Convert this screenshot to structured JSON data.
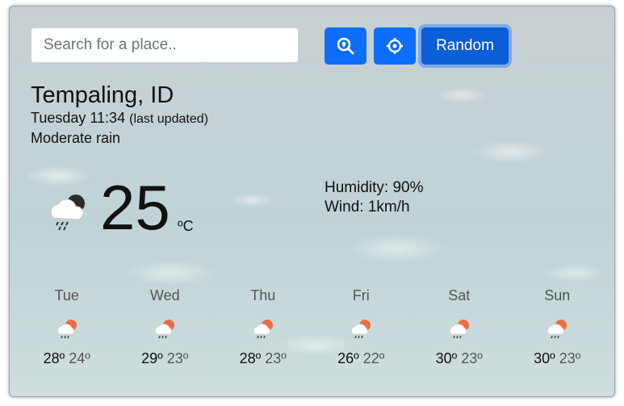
{
  "search": {
    "placeholder": "Search for a place.."
  },
  "buttons": {
    "random_label": "Random"
  },
  "location": {
    "name": "Tempaling, ID",
    "day_time": "Tuesday 11:34",
    "updated_note": "(last updated)",
    "condition": "Moderate rain"
  },
  "current": {
    "temperature": "25",
    "unit": "ºC",
    "humidity": "Humidity: 90%",
    "wind": "Wind: 1km/h",
    "icon": "rain-cloud-icon"
  },
  "forecast": [
    {
      "day": "Tue",
      "high": "28º",
      "low": "24º",
      "icon": "sun-rain-icon"
    },
    {
      "day": "Wed",
      "high": "29º",
      "low": "23º",
      "icon": "sun-rain-icon"
    },
    {
      "day": "Thu",
      "high": "28º",
      "low": "23º",
      "icon": "sun-rain-icon"
    },
    {
      "day": "Fri",
      "high": "26º",
      "low": "22º",
      "icon": "sun-rain-icon"
    },
    {
      "day": "Sat",
      "high": "30º",
      "low": "23º",
      "icon": "sun-rain-icon"
    },
    {
      "day": "Sun",
      "high": "30º",
      "low": "23º",
      "icon": "sun-rain-icon"
    }
  ],
  "colors": {
    "primary": "#0d6efd",
    "primary_active": "#0b5ed7",
    "sun": "#f06b3f"
  }
}
